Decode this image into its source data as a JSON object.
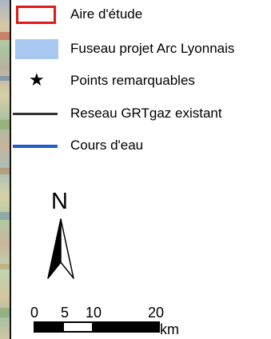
{
  "legend": {
    "items": [
      {
        "label": "Aire d'étude",
        "symbol": "red-outline-box"
      },
      {
        "label": "Fuseau projet Arc Lyonnais",
        "symbol": "light-blue-fill"
      },
      {
        "label": "Points remarquables",
        "symbol": "black-star"
      },
      {
        "label": "Reseau GRTgaz existant",
        "symbol": "dark-gray-line"
      },
      {
        "label": "Cours d'eau",
        "symbol": "blue-line"
      }
    ],
    "star_glyph": "★"
  },
  "north_arrow": {
    "letter": "N"
  },
  "scale_bar": {
    "ticks": [
      "0",
      "5",
      "10",
      "20"
    ],
    "unit": "km"
  },
  "colors": {
    "study_area_outline": "#e01a1a",
    "fuseau_fill": "#a8c8f2",
    "grtgaz_line": "#333333",
    "cours_eau_line": "#1f5ccf"
  }
}
